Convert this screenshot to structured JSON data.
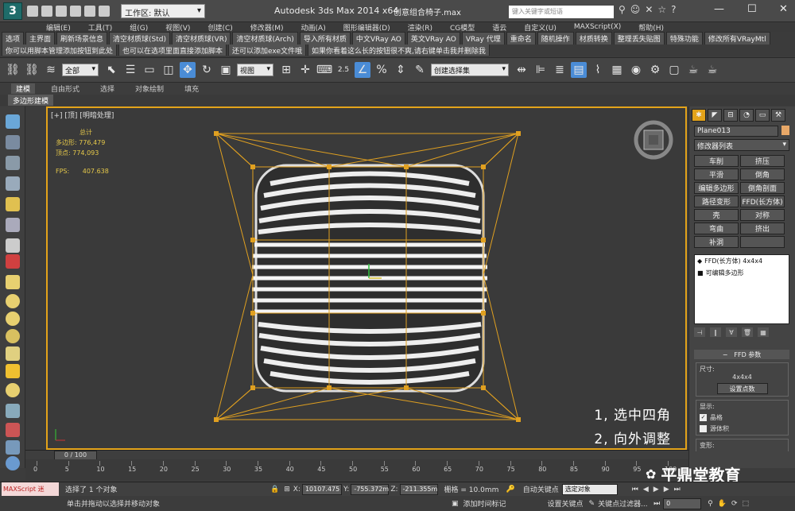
{
  "titlebar": {
    "logo": "3",
    "workspace_label": "工作区: 默认",
    "app_title": "Autodesk 3ds Max  2014 x64",
    "file_name": "创意组合椅子.max",
    "search_placeholder": "键入关键字或短语",
    "help": "?"
  },
  "menu": [
    "编辑(E)",
    "工具(T)",
    "组(G)",
    "视图(V)",
    "创建(C)",
    "修改器(M)",
    "动画(A)",
    "图形编辑器(D)",
    "渲染(R)",
    "CG模型",
    "语云",
    "自定义(U)",
    "MAXScript(X)",
    "帮助(H)"
  ],
  "plugins_row1": [
    "选项",
    "主界面",
    "刷新场景信息",
    "清空材质球(Std)",
    "清空材质球(VR)",
    "清空材质球(Arch)",
    "导入所有材质",
    "中文VRay AO",
    "英文VRay AO",
    "VRay 代理",
    "重命名",
    "随机操作",
    "材质转换",
    "整理丢失贴图",
    "特殊功能",
    "修改所有VRayMtl"
  ],
  "plugins_row2": [
    "你可以用脚本管理添加按钮到此处",
    "也可以在选项里面直接添加脚本",
    "还可以添加exe文件哦",
    "如果你看着这么长的按钮很不爽,请右键单击我并删除我"
  ],
  "toolbar": {
    "filter": "全部",
    "ref_coord": "视图",
    "snap": "2.5",
    "named_sel": "创建选择集"
  },
  "ribbon": {
    "tabs": [
      "建模",
      "自由形式",
      "选择",
      "对象绘制",
      "填充"
    ],
    "active_subtab": "多边形建模"
  },
  "viewport": {
    "label": "[+] [顶] [明暗处理]",
    "stats_title": "总计",
    "polys_label": "多边形:",
    "polys": "776,479",
    "verts_label": "顶点:",
    "verts": "774,093",
    "fps_label": "FPS:",
    "fps": "407.638",
    "note1": "1, 选中四角",
    "note2": "2, 向外调整"
  },
  "command_panel": {
    "object_name": "Plane013",
    "object_color": "#e8a868",
    "modifier_list": "修改器列表",
    "buttons": [
      "车削",
      "挤压",
      "平滑",
      "倒角",
      "编辑多边形",
      "倒角剖面",
      "路径变形",
      "FFD(长方体)",
      "壳",
      "对称",
      "弯曲",
      "挤出",
      "补洞",
      ""
    ],
    "stack": [
      "FFD(长方体) 4x4x4",
      "可编辑多边形"
    ],
    "rollout_title": "FFD 参数",
    "size_label": "尺寸:",
    "size_value": "4x4x4",
    "set_points": "设置点数",
    "display_label": "显示:",
    "lattice": "晶格",
    "source_volume": "源体积",
    "deform_label": "变形:"
  },
  "timeline": {
    "frame": "0 / 100",
    "ticks": [
      "0",
      "5",
      "10",
      "15",
      "20",
      "25",
      "30",
      "35",
      "40",
      "45",
      "50",
      "55",
      "60",
      "65",
      "70",
      "75",
      "80",
      "85",
      "90",
      "95",
      "100"
    ]
  },
  "status": {
    "maxscript": "MAXScript 迷",
    "selected": "选择了 1 个对象",
    "hint": "单击并拖动以选择并移动对象",
    "x_label": "X:",
    "x": "10107.475",
    "y_label": "Y:",
    "y": "-755.372m",
    "z_label": "Z:",
    "z": "-211.355m",
    "grid": "栅格 = 10.0mm",
    "autokey": "自动关键点",
    "setkey": "设置关键点",
    "sel_obj": "选定对象",
    "key_filters": "关键点过滤器...",
    "add_tag": "添加时间标记",
    "frame_field": "0"
  },
  "watermark": "平鼎堂教育"
}
